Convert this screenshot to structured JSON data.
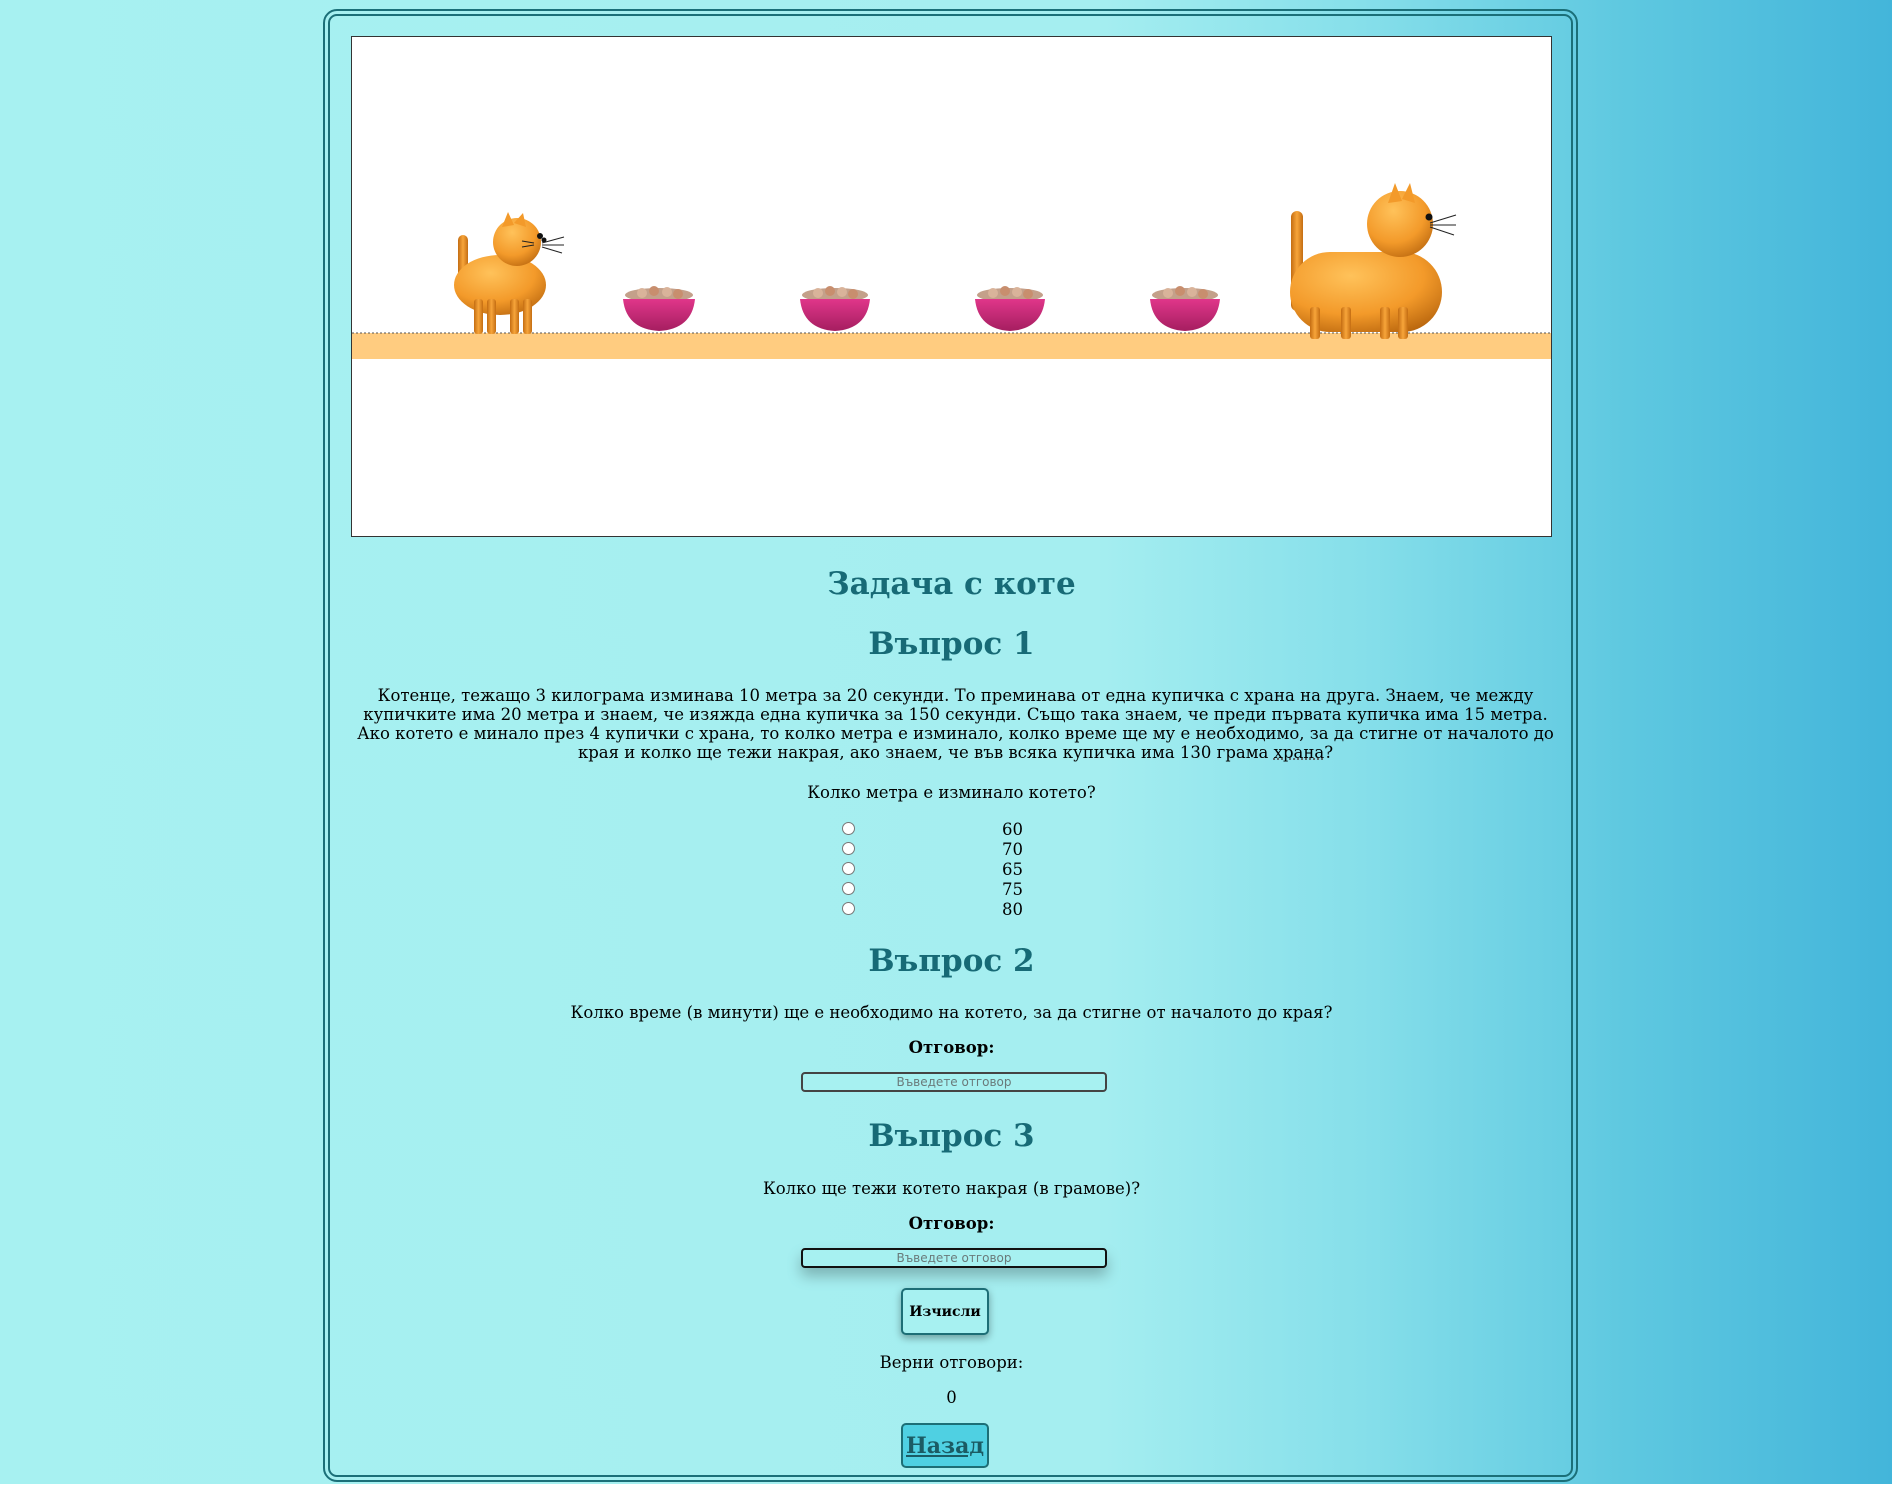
{
  "page": {
    "title": "Задача с коте"
  },
  "question1": {
    "heading": "Въпрос 1",
    "text_before_spell": "Котенце, тежащо 3 килограма изминава 10 метра за 20 секунди. То преминава от една купичка с храна на друга. Знаем, че между купичките има 20 метра и знаем, че изяжда една купичка за 150 секунди. Също така знаем, че преди първата купичка има 15 метра. Ако котето е минало през 4 купички с храна, то колко метра е изминало, колко време ще му е необходимо, за да стигне от началото до края и колко ще тежи накрая, ако знаем, че във всяка купичка има 130 грама ",
    "spell_word": "храна",
    "text_after_spell": "?",
    "prompt": "Колко метра е изминало котето?",
    "options": [
      "60",
      "70",
      "65",
      "75",
      "80"
    ]
  },
  "question2": {
    "heading": "Въпрос 2",
    "prompt": "Колко време (в минути) ще е необходимо на котето, за да стигне от началото до края?",
    "answer_label": "Отговор:",
    "placeholder": "Въведете отговор"
  },
  "question3": {
    "heading": "Въпрос 3",
    "prompt": "Колко ще тежи котето накрая (в грамове)?",
    "answer_label": "Отговор:",
    "placeholder": "Въведете отговор"
  },
  "actions": {
    "calculate_label": "Изчисли",
    "correct_label": "Верни отговори:",
    "correct_count": "0",
    "back_label": "Назад"
  },
  "colors": {
    "heading": "#176a76",
    "frame": "#1b6f78",
    "cat": "#f39a2a",
    "bowl": "#d6307f",
    "floor": "#ffcc80"
  }
}
